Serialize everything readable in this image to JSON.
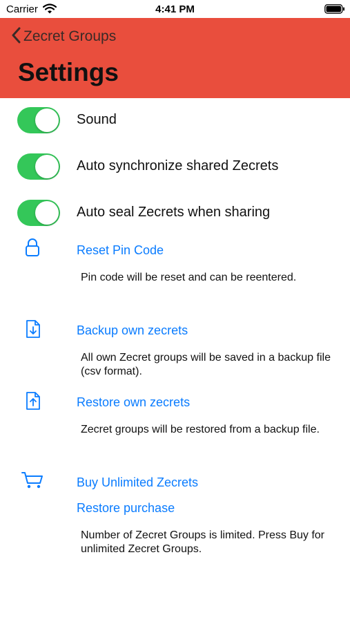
{
  "status": {
    "carrier": "Carrier",
    "time": "4:41 PM"
  },
  "nav": {
    "back_label": "Zecret Groups",
    "title": "Settings"
  },
  "toggles": [
    {
      "label": "Sound",
      "on": true
    },
    {
      "label": "Auto synchronize shared Zecrets",
      "on": true
    },
    {
      "label": "Auto seal Zecrets when sharing",
      "on": true
    }
  ],
  "actions": {
    "reset_pin": {
      "label": "Reset Pin Code",
      "desc": "Pin code will be reset and can be reentered."
    },
    "backup": {
      "label": "Backup own zecrets",
      "desc": "All own Zecret groups will be saved in a backup file (csv format)."
    },
    "restore": {
      "label": "Restore own zecrets",
      "desc": "Zecret groups will be restored from a backup file."
    },
    "buy": {
      "label": "Buy Unlimited Zecrets",
      "restore_label": "Restore purchase",
      "desc": "Number of Zecret Groups is limited. Press Buy for unlimited Zecret Groups."
    }
  },
  "icons": [
    "wifi-icon",
    "battery-icon",
    "chevron-left-icon",
    "lock-icon",
    "document-download-icon",
    "document-upload-icon",
    "cart-icon"
  ],
  "colors": {
    "nav_bar": "#e94e3d",
    "toggle_on": "#34c759",
    "link": "#0a7cff"
  }
}
